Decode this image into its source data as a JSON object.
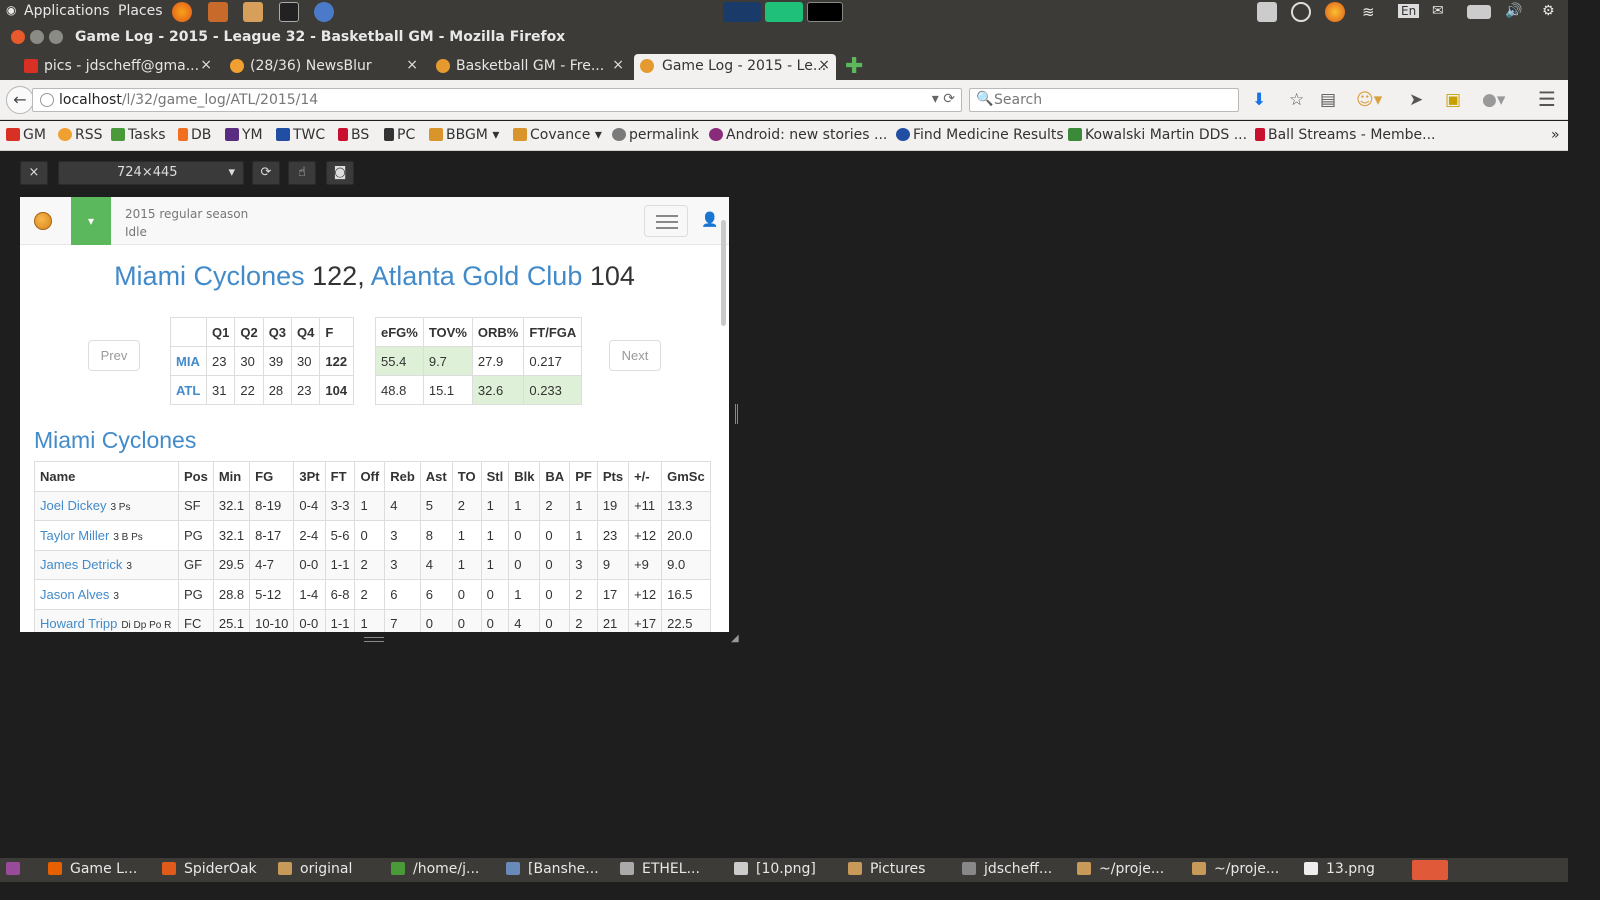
{
  "top_panel": {
    "applications": "Applications",
    "places": "Places",
    "lang": "En"
  },
  "window": {
    "title": "Game Log - 2015 - League 32 - Basketball GM - Mozilla Firefox"
  },
  "tabs": [
    {
      "label": "pics - jdscheff@gma...",
      "icon": "gmail-icon",
      "close": "×"
    },
    {
      "label": "(28/36) NewsBlur",
      "icon": "newsblur-icon",
      "close": "×"
    },
    {
      "label": "Basketball GM - Fre...",
      "icon": "basketball-icon",
      "close": "×"
    },
    {
      "label": "Game Log - 2015 - Le...",
      "icon": "basketball-icon",
      "close": "×"
    }
  ],
  "newtab": "✚",
  "nav": {
    "url_host": "localhost",
    "url_path": "/l/32/game_log/ATL/2015/14",
    "url_right": "▾ ⟳",
    "search_placeholder": "Search"
  },
  "bookmarks": [
    {
      "label": "GM",
      "color": "#d93025"
    },
    {
      "label": "RSS",
      "color": "#f0a030"
    },
    {
      "label": "Tasks",
      "color": "#4a9a3a"
    },
    {
      "label": "DB",
      "color": "#f07020"
    },
    {
      "label": "YM",
      "color": "#5a2d82"
    },
    {
      "label": "TWC",
      "color": "#1f4ea3"
    },
    {
      "label": "BS",
      "color": "#c8102e"
    },
    {
      "label": "PC",
      "color": "#333333"
    },
    {
      "label": "BBGM ▾",
      "color": "#d9952b"
    },
    {
      "label": "Covance ▾",
      "color": "#d9952b"
    },
    {
      "label": "permalink",
      "color": "#7a7a7a"
    },
    {
      "label": "Android: new stories ...",
      "color": "#8a2a7a"
    },
    {
      "label": "Find Medicine Results",
      "color": "#1f4ea3"
    },
    {
      "label": "Kowalski Martin DDS ...",
      "color": "#3a8a3a"
    },
    {
      "label": "Ball Streams - Membe...",
      "color": "#c8102e"
    }
  ],
  "bookmarks_more": "»",
  "rdm": {
    "close": "×",
    "size": "724×445",
    "arrow": "▾",
    "rotate": "⟳",
    "touch": "☝",
    "screenshot": "◙"
  },
  "bbgm": {
    "season": "2015 regular season",
    "status": "Idle",
    "dropdown": "▾",
    "user": "👤"
  },
  "headline": {
    "team1": "Miami Cyclones",
    "score1": "122",
    "sep": ",",
    "team2": "Atlanta Gold Club",
    "score2": "104"
  },
  "pager": {
    "prev": "Prev",
    "next": "Next"
  },
  "linescore": {
    "headers": [
      "",
      "Q1",
      "Q2",
      "Q3",
      "Q4",
      "F"
    ],
    "rows": [
      {
        "team": "MIA",
        "q": [
          "23",
          "30",
          "39",
          "30"
        ],
        "f": "122"
      },
      {
        "team": "ATL",
        "q": [
          "31",
          "22",
          "28",
          "23"
        ],
        "f": "104"
      }
    ]
  },
  "four_factors": {
    "headers": [
      "eFG%",
      "TOV%",
      "ORB%",
      "FT/FGA"
    ],
    "rows": [
      {
        "values": [
          "55.4",
          "9.7",
          "27.9",
          "0.217"
        ],
        "highlight": [
          true,
          true,
          false,
          false
        ]
      },
      {
        "values": [
          "48.8",
          "15.1",
          "32.6",
          "0.233"
        ],
        "highlight": [
          false,
          false,
          true,
          true
        ]
      }
    ]
  },
  "team_heading": "Miami Cyclones",
  "boxscore": {
    "headers": [
      "Name",
      "Pos",
      "Min",
      "FG",
      "3Pt",
      "FT",
      "Off",
      "Reb",
      "Ast",
      "TO",
      "Stl",
      "Blk",
      "BA",
      "PF",
      "Pts",
      "+/-",
      "GmSc"
    ],
    "rows": [
      {
        "name": "Joel Dickey",
        "skills": "3 Ps",
        "cells": [
          "SF",
          "32.1",
          "8-19",
          "0-4",
          "3-3",
          "1",
          "4",
          "5",
          "2",
          "1",
          "1",
          "2",
          "1",
          "19",
          "+11",
          "13.3"
        ]
      },
      {
        "name": "Taylor Miller",
        "skills": "3 B Ps",
        "cells": [
          "PG",
          "32.1",
          "8-17",
          "2-4",
          "5-6",
          "0",
          "3",
          "8",
          "1",
          "1",
          "0",
          "0",
          "1",
          "23",
          "+12",
          "20.0"
        ]
      },
      {
        "name": "James Detrick",
        "skills": "3",
        "cells": [
          "GF",
          "29.5",
          "4-7",
          "0-0",
          "1-1",
          "2",
          "3",
          "4",
          "1",
          "1",
          "0",
          "0",
          "3",
          "9",
          "+9",
          "9.0"
        ]
      },
      {
        "name": "Jason Alves",
        "skills": "3",
        "cells": [
          "PG",
          "28.8",
          "5-12",
          "1-4",
          "6-8",
          "2",
          "6",
          "6",
          "0",
          "0",
          "1",
          "0",
          "2",
          "17",
          "+12",
          "16.5"
        ]
      },
      {
        "name": "Howard Tripp",
        "skills": "Di Dp Po R",
        "cells": [
          "FC",
          "25.1",
          "10-10",
          "0-0",
          "1-1",
          "1",
          "7",
          "0",
          "0",
          "0",
          "4",
          "0",
          "2",
          "21",
          "+17",
          "22.5"
        ]
      }
    ]
  },
  "taskbar": [
    {
      "label": "Game L...",
      "color": "#e66000"
    },
    {
      "label": "SpiderOak",
      "color": "#e05a1a"
    },
    {
      "label": "original",
      "color": "#c89a5a"
    },
    {
      "label": "/home/j...",
      "color": "#4a9a3a"
    },
    {
      "label": "[Banshe...",
      "color": "#6a8aba"
    },
    {
      "label": "ETHEL...",
      "color": "#aaaaaa"
    },
    {
      "label": "[10.png]",
      "color": "#cccccc"
    },
    {
      "label": "Pictures",
      "color": "#c89a5a"
    },
    {
      "label": "jdscheff...",
      "color": "#888888"
    },
    {
      "label": "~/proje...",
      "color": "#c89a5a"
    },
    {
      "label": "~/proje...",
      "color": "#c89a5a"
    },
    {
      "label": "13.png",
      "color": "#eeeeee"
    }
  ]
}
